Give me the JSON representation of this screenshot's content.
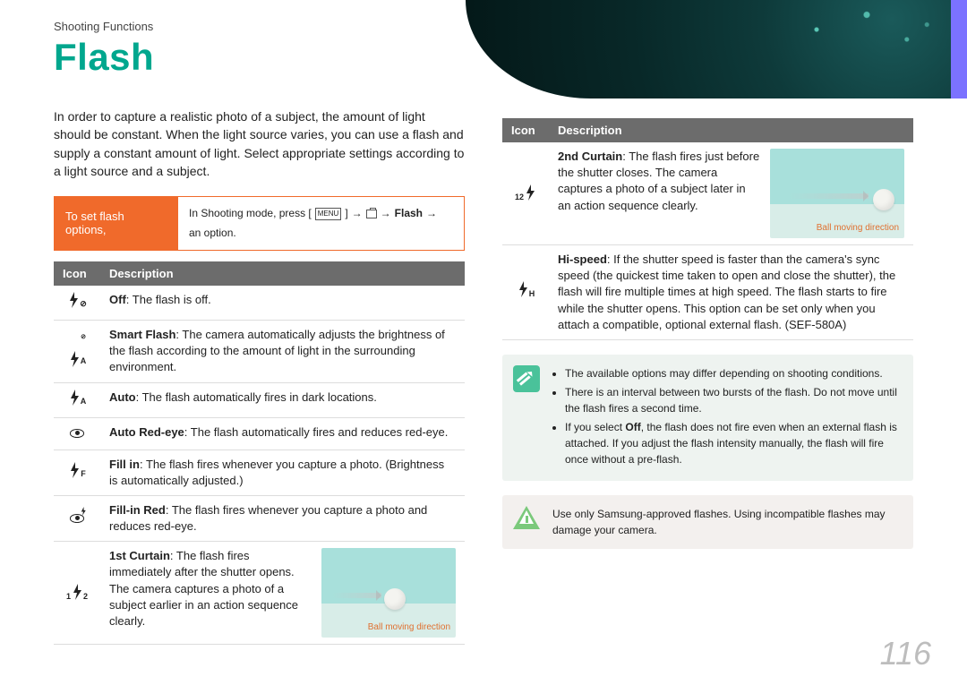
{
  "breadcrumb": "Shooting Functions",
  "title": "Flash",
  "intro": "In order to capture a realistic photo of a subject, the amount of light should be constant. When the light source varies, you can use a flash and supply a constant amount of light. Select appropriate settings according to a light source and a subject.",
  "option_box": {
    "tab": "To set flash options,",
    "lead": "In Shooting mode, press [",
    "menu": "MENU",
    "mid": "] ",
    "flash_label": "Flash",
    "tail": "an option."
  },
  "table_headers": {
    "icon": "Icon",
    "desc": "Description"
  },
  "rows_left": [
    {
      "icon_sub": "⊘",
      "bold": "Off",
      "text": ": The flash is off."
    },
    {
      "icon_sub_small": "A",
      "icon_variant": "smart",
      "bold": "Smart Flash",
      "text": ": The camera automatically adjusts the brightness of the flash according to the amount of light in the surrounding environment."
    },
    {
      "icon_sub_small": "A",
      "bold": "Auto",
      "text": ": The flash automatically fires in dark locations."
    },
    {
      "icon_eye": true,
      "bold": "Auto Red-eye",
      "text": ": The flash automatically fires and reduces red-eye."
    },
    {
      "icon_sub_small": "F",
      "bold": "Fill in",
      "text": ": The flash fires whenever you capture a photo. (Brightness is automatically adjusted.)"
    },
    {
      "icon_eye_bolt": true,
      "bold": "Fill-in Red",
      "text": ": The flash fires whenever you capture a photo and reduces red-eye."
    },
    {
      "icon_sub_curtain": "1⯈2",
      "curtain_pre": "1",
      "curtain_post": "2",
      "bold": "1st Curtain",
      "text": ": The flash fires immediately after the shutter opens. The camera captures a photo of a subject earlier in an action sequence clearly.",
      "thumb": "left",
      "caption": "Ball moving direction"
    }
  ],
  "rows_right": [
    {
      "curtain_pre": "1",
      "curtain_post": "2",
      "bold": "2nd Curtain",
      "text": ": The flash fires just before the shutter closes. The camera captures a photo of a subject later in an action sequence clearly.",
      "thumb": "right",
      "caption": "Ball moving direction"
    },
    {
      "icon_sub_small": "H",
      "bold": "Hi-speed",
      "text": ": If the shutter speed is faster than the camera's sync speed (the quickest time taken to open and close the shutter), the flash will fire multiple times at high speed. The flash starts to fire while the shutter opens. This option can be set only when you attach a compatible, optional external flash. (SEF-580A)"
    }
  ],
  "notes": [
    "The available options may differ depending on shooting conditions.",
    "There is an interval between two bursts of the flash. Do not move until the flash fires a second time.",
    "If you select Off, the flash does not fire even when an external flash is attached. If you adjust the flash intensity manually, the flash will fire once without a pre-flash."
  ],
  "note_bold_in_3": "Off",
  "warning": "Use only Samsung-approved flashes. Using incompatible flashes may damage your camera.",
  "page_number": "116"
}
